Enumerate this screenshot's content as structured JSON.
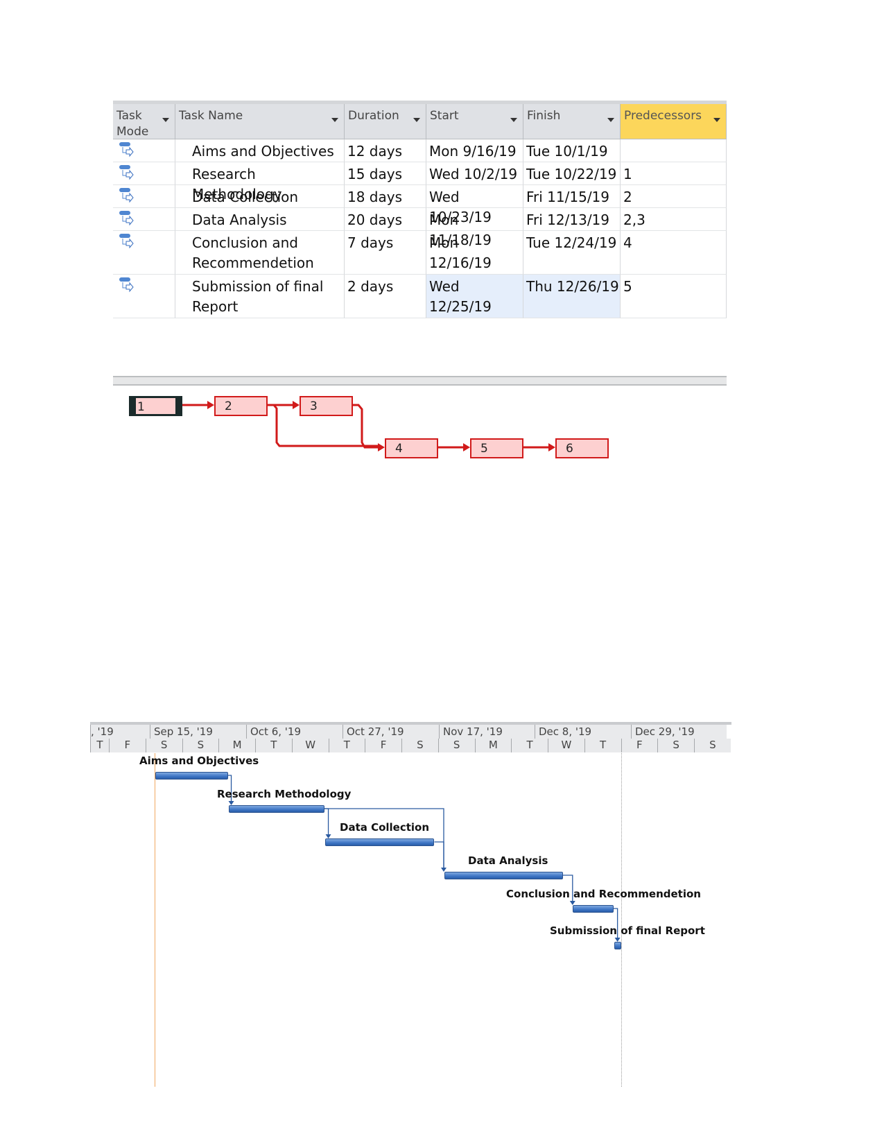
{
  "table": {
    "headers": [
      {
        "label": "Task Mode",
        "sub": "Mode",
        "main": "Task"
      },
      {
        "label": "Task Name"
      },
      {
        "label": "Duration"
      },
      {
        "label": "Start"
      },
      {
        "label": "Finish"
      },
      {
        "label": "Predecessors"
      }
    ],
    "rows": [
      {
        "id": "1",
        "name": "Aims and Objectives",
        "name2": "",
        "duration": "12 days",
        "start": "Mon 9/16/19",
        "finish": "Tue 10/1/19",
        "pred": ""
      },
      {
        "id": "2",
        "name": "Research Methodology",
        "name2": "",
        "duration": "15 days",
        "start": "Wed 10/2/19",
        "finish": "Tue 10/22/19",
        "pred": "1"
      },
      {
        "id": "3",
        "name": "Data Collection",
        "name2": "",
        "duration": "18 days",
        "start": "Wed 10/23/19",
        "finish": "Fri 11/15/19",
        "pred": "2"
      },
      {
        "id": "4",
        "name": "Data Analysis",
        "name2": "",
        "duration": "20 days",
        "start": "Mon 11/18/19",
        "finish": "Fri 12/13/19",
        "pred": "2,3"
      },
      {
        "id": "5",
        "name": "Conclusion and",
        "name2": "Recommendetion",
        "duration": "7 days",
        "start": "Mon 12/16/19",
        "finish": "Tue 12/24/19",
        "pred": "4"
      },
      {
        "id": "6",
        "name": "Submission of final",
        "name2": "Report",
        "duration": "2 days",
        "start": "Wed 12/25/19",
        "finish": "Thu 12/26/19",
        "pred": "5"
      }
    ]
  },
  "network": {
    "nodes": [
      "1",
      "2",
      "3",
      "4",
      "5",
      "6"
    ],
    "color": "#d11a1a"
  },
  "gantt": {
    "major": [
      ", '19",
      "Sep 15, '19",
      "Oct 6, '19",
      "Oct 27, '19",
      "Nov 17, '19",
      "Dec 8, '19",
      "Dec 29, '19"
    ],
    "minor": [
      "T",
      "F",
      "S",
      "S",
      "M",
      "T",
      "W",
      "T",
      "F",
      "S",
      "S",
      "M",
      "T",
      "W",
      "T",
      "F",
      "S",
      "S"
    ],
    "labels": [
      "Aims and Objectives",
      "Research Methodology",
      "Data Collection",
      "Data Analysis",
      "Conclusion and Recommendetion",
      "Submission of final Report"
    ],
    "bar_color": "#3d74c4"
  }
}
